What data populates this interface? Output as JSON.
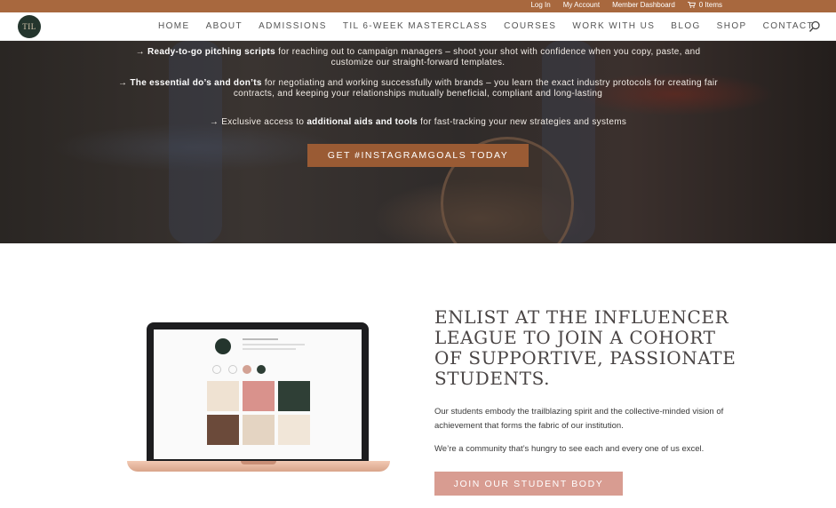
{
  "topbar": {
    "login": "Log In",
    "account": "My Account",
    "dashboard": "Member Dashboard",
    "cart": "0 Items",
    "bg_color": "#a8683e"
  },
  "nav": {
    "logo_text": "TIL",
    "items": [
      {
        "label": "HOME"
      },
      {
        "label": "ABOUT"
      },
      {
        "label": "ADMISSIONS"
      },
      {
        "label": "TIL 6-WEEK MASTERCLASS"
      },
      {
        "label": "COURSES"
      },
      {
        "label": "WORK WITH US"
      },
      {
        "label": "BLOG"
      },
      {
        "label": "SHOP"
      },
      {
        "label": "CONTACT"
      }
    ],
    "search_icon": "search-icon"
  },
  "hero": {
    "line1_bold": "Ready-to-go pitching scripts",
    "line1_rest": " for reaching out to campaign managers – shoot your shot with confidence when you copy, paste, and",
    "line1_cont": "customize our straight-forward templates.",
    "line2_bold": "The essential do’s and don’ts",
    "line2_rest": " for negotiating and working successfully with brands – you learn the exact industry protocols for creating fair",
    "line2_cont": "contracts, and keeping your relationships mutually beneficial, compliant and long-lasting",
    "line3_pre": "Exclusive access to ",
    "line3_bold": "additional aids and tools",
    "line3_rest": " for fast-tracking your new strategies and systems",
    "arrow": "→",
    "cta": "GET #INSTAGRAMGOALS TODAY",
    "cta_color": "#9a5b34"
  },
  "main": {
    "heading": "ENLIST AT THE INFLUENCER LEAGUE TO JOIN A COHORT OF SUPPORTIVE, PASSIONATE STUDENTS.",
    "para1": "Our students embody the trailblazing spirit and the collective-minded vision of achievement that forms the fabric of our institution.",
    "para2": "We’re a community that’s hungry to see each and every one of us excel.",
    "button": "JOIN OUR STUDENT BODY",
    "button_color": "#d89c91"
  }
}
